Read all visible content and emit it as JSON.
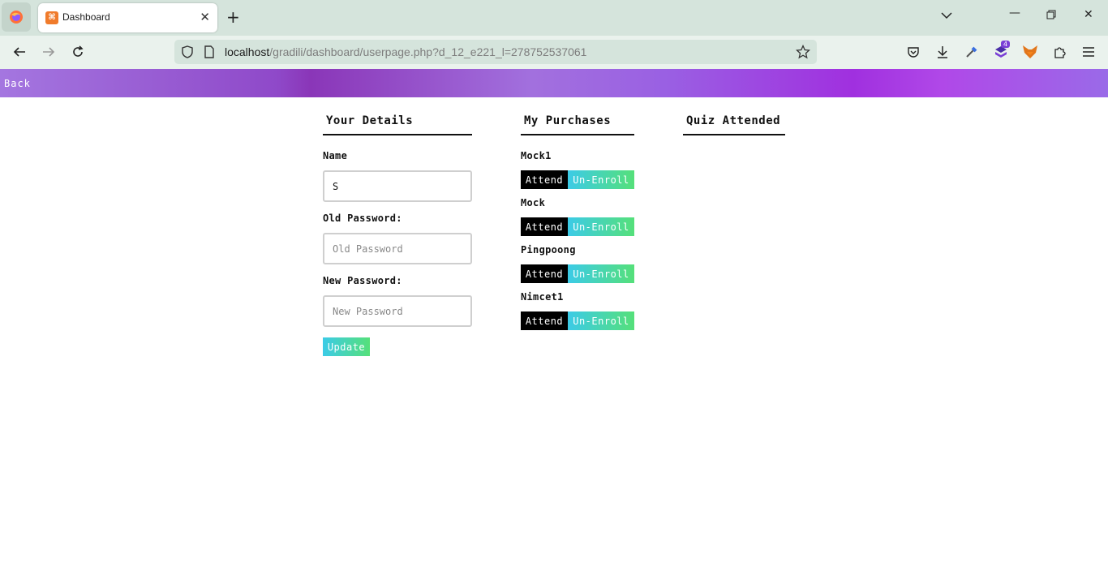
{
  "browser": {
    "tab_title": "Dashboard",
    "url_host": "localhost",
    "url_path": "/gradili/dashboard/userpage.php?d_12_e221_l=278752537061",
    "extension_badge": "4",
    "icons": [
      "firefox-icon",
      "close-icon",
      "plus-icon",
      "chevron-down-icon",
      "minimize-icon",
      "restore-icon",
      "back-arrow-icon",
      "forward-arrow-icon",
      "reload-icon",
      "shield-icon",
      "page-icon",
      "star-icon",
      "pocket-icon",
      "download-icon",
      "eyedropper-icon",
      "extension-icon",
      "fox-icon",
      "puzzle-icon",
      "menu-icon"
    ]
  },
  "header": {
    "back_label": "Back",
    "gradient_colors": [
      "#a476e0",
      "#8a36b8",
      "#a030df",
      "#9a6ae8"
    ]
  },
  "details": {
    "title": "Your Details",
    "name_label": "Name",
    "name_value": "S",
    "old_password_label": "Old Password:",
    "old_password_placeholder": "Old Password",
    "new_password_label": "New Password:",
    "new_password_placeholder": "New Password",
    "update_label": "Update"
  },
  "purchases": {
    "title": "My Purchases",
    "attend_label": "Attend",
    "unenroll_label": "Un-Enroll",
    "items": [
      "Mock1",
      "Mock",
      "Pingpoong",
      "Nimcet1"
    ]
  },
  "quiz": {
    "title": "Quiz Attended"
  },
  "colors": {
    "button_gradient_start": "#3ccbe7",
    "button_gradient_end": "#55e07a",
    "attend_bg": "#000000"
  }
}
